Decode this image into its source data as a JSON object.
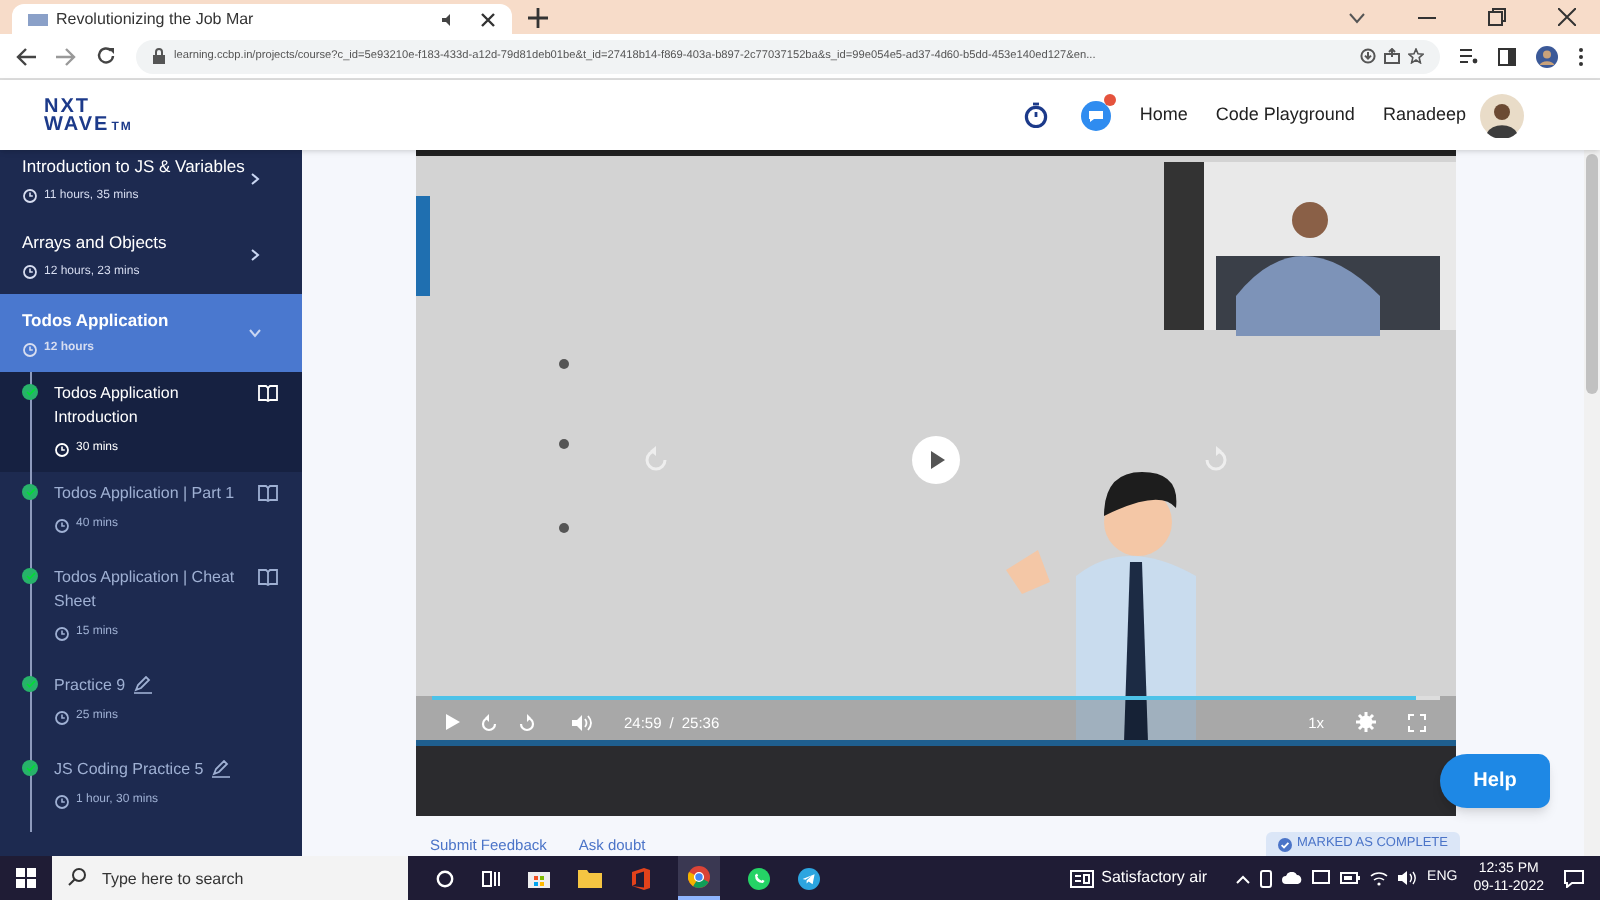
{
  "browser": {
    "tab_title": "Revolutionizing the Job Mar",
    "url": "learning.ccbp.in/projects/course?c_id=5e93210e-f183-433d-a12d-79d81deb01be&t_id=27418b14-f869-403a-b897-2c77037152ba&s_id=99e054e5-ad37-4d60-b5dd-453e140ed127&en..."
  },
  "header": {
    "logo_top": "NXT",
    "logo_bottom": "WAVE",
    "logo_mark": "TM",
    "has_notification": true,
    "nav": [
      {
        "label": "Home"
      },
      {
        "label": "Code Playground"
      }
    ],
    "user_name": "Ranadeep"
  },
  "sidebar": {
    "modules": [
      {
        "title": "Introduction to JS & Variables",
        "duration": "11 hours, 35 mins",
        "expanded": false
      },
      {
        "title": "Arrays and Objects",
        "duration": "12 hours, 23 mins",
        "expanded": false
      },
      {
        "title": "Todos Application",
        "duration": "12 hours",
        "expanded": true,
        "children": [
          {
            "title": "Todos Application Introduction",
            "duration": "30 mins",
            "kind": "reading",
            "selected": true,
            "completed": true
          },
          {
            "title": "Todos Application | Part 1",
            "duration": "40 mins",
            "kind": "reading",
            "selected": false,
            "completed": true
          },
          {
            "title": "Todos Application | Cheat Sheet",
            "duration": "15 mins",
            "kind": "reading",
            "selected": false,
            "completed": true
          },
          {
            "title": "Practice 9",
            "duration": "25 mins",
            "kind": "practice",
            "selected": false,
            "completed": true
          },
          {
            "title": "JS Coding Practice 5",
            "duration": "1 hour, 30 mins",
            "kind": "practice",
            "selected": false,
            "completed": true
          }
        ]
      }
    ]
  },
  "video": {
    "playing": false,
    "current_time": "24:59",
    "separator": "/",
    "total_time": "25:36",
    "speed": "1x",
    "progress": {
      "level": 0.976
    }
  },
  "footer_links": [
    {
      "label": "Submit Feedback"
    },
    {
      "label": "Ask doubt"
    }
  ],
  "complete_button": {
    "label": "MARKED AS COMPLETE",
    "completed": true
  },
  "help_button": {
    "label": "Help"
  },
  "taskbar": {
    "search_placeholder": "Type here to search",
    "weather": "Satisfactory air",
    "language": "ENG",
    "time": "12:35 PM",
    "date": "09-11-2022"
  }
}
